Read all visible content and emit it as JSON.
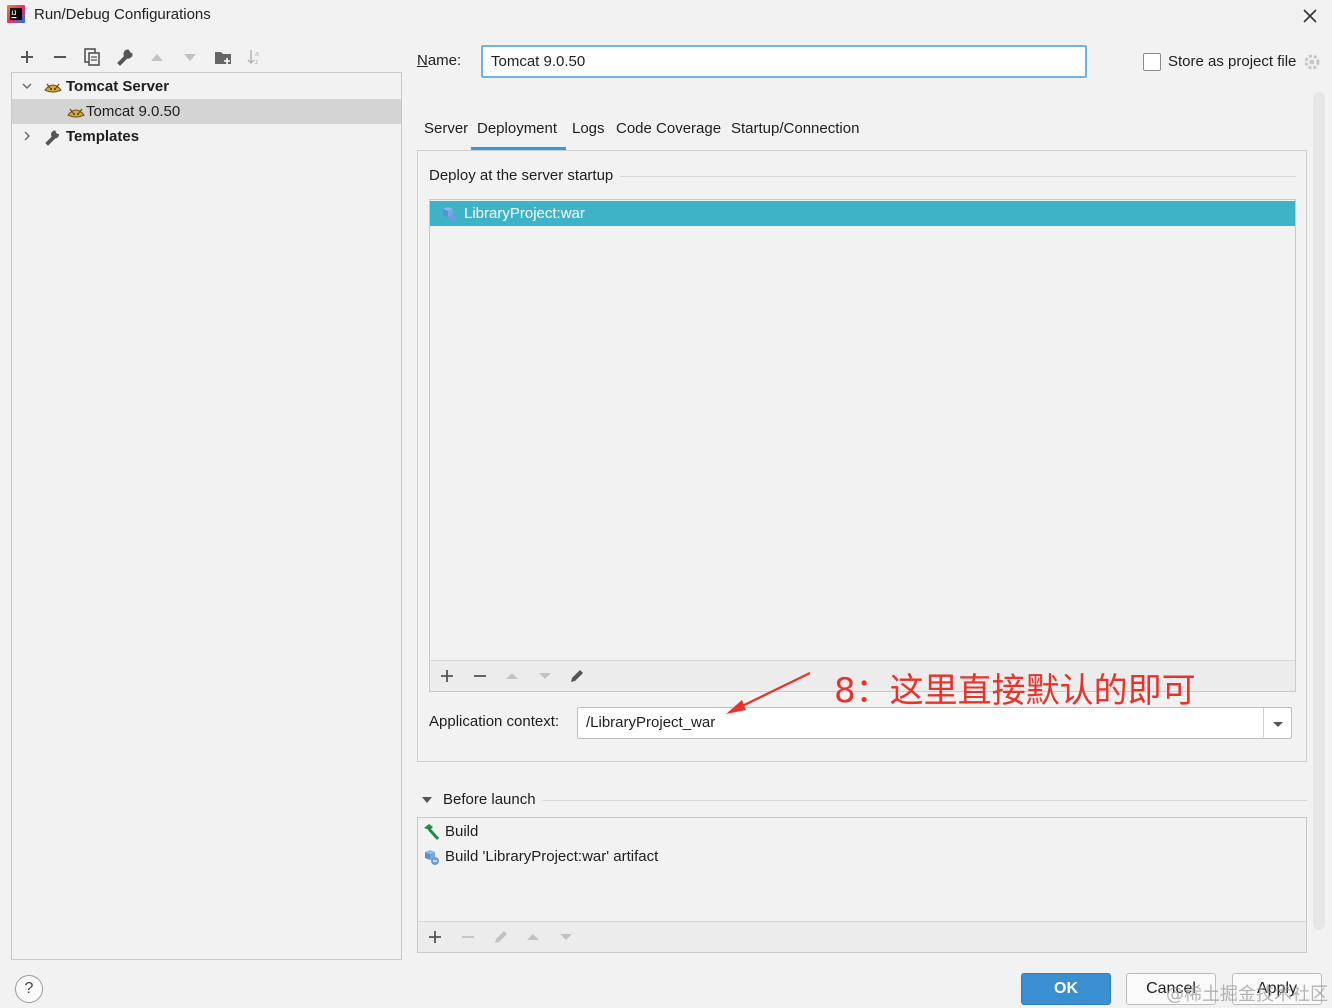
{
  "window": {
    "title": "Run/Debug Configurations"
  },
  "sidebar": {
    "tree": {
      "group_label": "Tomcat Server",
      "child_label": "Tomcat 9.0.50",
      "templates_label": "Templates"
    }
  },
  "config": {
    "name_label": "Name:",
    "name_value": "Tomcat 9.0.50",
    "store_label": "Store as project file",
    "store_checked": false
  },
  "tabs": [
    {
      "label": "Server"
    },
    {
      "label": "Deployment",
      "active": true
    },
    {
      "label": "Logs"
    },
    {
      "label": "Code Coverage"
    },
    {
      "label": "Startup/Connection"
    }
  ],
  "deployment": {
    "heading": "Deploy at the server startup",
    "items": [
      "LibraryProject:war"
    ],
    "context_label": "Application context:",
    "context_value": "/LibraryProject_war"
  },
  "annotation": {
    "text": "8：这里直接默认的即可",
    "color": "#e8322c"
  },
  "before_launch": {
    "label": "Before launch",
    "items": [
      "Build",
      "Build 'LibraryProject:war' artifact"
    ]
  },
  "buttons": {
    "help": "?",
    "ok": "OK",
    "cancel": "Cancel",
    "apply": "Apply"
  },
  "watermark": "@稀土掘金技术社区",
  "colors": {
    "accent": "#3a9ad9",
    "selection": "#3eb2c6",
    "ok_button": "#3a8fd0"
  }
}
